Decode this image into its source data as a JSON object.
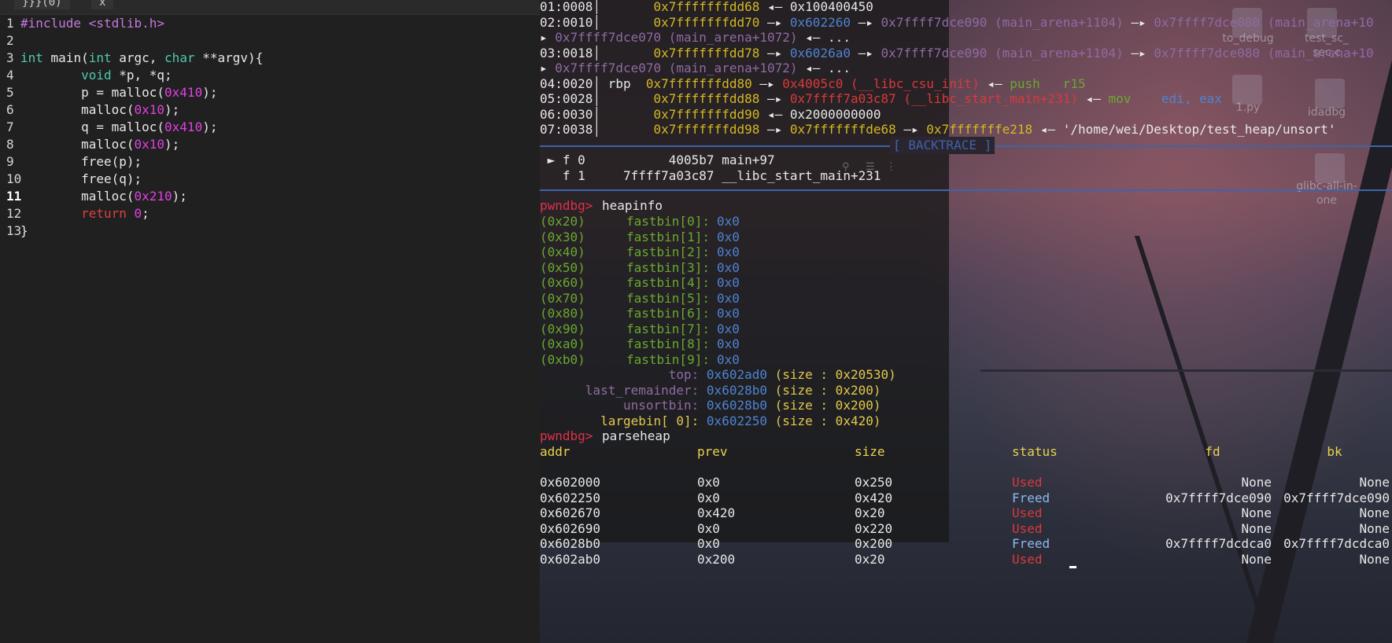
{
  "editor": {
    "tabs": [
      "}}}(0)",
      "x"
    ],
    "lines": [
      {
        "n": "1",
        "parts": [
          [
            "pp",
            "#include "
          ],
          [
            "pp2",
            "<stdlib.h>"
          ]
        ]
      },
      {
        "n": "2",
        "parts": []
      },
      {
        "n": "3",
        "parts": [
          [
            "ty",
            "int"
          ],
          [
            "tx",
            " main("
          ],
          [
            "ty",
            "int"
          ],
          [
            "tx",
            " argc, "
          ],
          [
            "ty",
            "char"
          ],
          [
            "tx",
            " **argv){"
          ]
        ]
      },
      {
        "n": "4",
        "parts": [
          [
            "tx",
            "        "
          ],
          [
            "ty",
            "void"
          ],
          [
            "tx",
            " *p, *q;"
          ]
        ]
      },
      {
        "n": "5",
        "parts": [
          [
            "tx",
            "        p = malloc("
          ],
          [
            "num",
            "0x410"
          ],
          [
            "tx",
            ");"
          ]
        ]
      },
      {
        "n": "6",
        "parts": [
          [
            "tx",
            "        malloc("
          ],
          [
            "num",
            "0x10"
          ],
          [
            "tx",
            ");"
          ]
        ]
      },
      {
        "n": "7",
        "parts": [
          [
            "tx",
            "        q = malloc("
          ],
          [
            "num",
            "0x410"
          ],
          [
            "tx",
            ");"
          ]
        ]
      },
      {
        "n": "8",
        "parts": [
          [
            "tx",
            "        malloc("
          ],
          [
            "num",
            "0x10"
          ],
          [
            "tx",
            ");"
          ]
        ]
      },
      {
        "n": "9",
        "parts": [
          [
            "tx",
            "        free(p);"
          ]
        ]
      },
      {
        "n": "10",
        "parts": [
          [
            "tx",
            "        free(q);"
          ]
        ]
      },
      {
        "n": "11",
        "parts": [
          [
            "tx",
            "        malloc("
          ],
          [
            "num",
            "0x210"
          ],
          [
            "tx",
            ");"
          ]
        ]
      },
      {
        "n": "12",
        "parts": [
          [
            "tx",
            "        "
          ],
          [
            "kw",
            "return"
          ],
          [
            "tx",
            " "
          ],
          [
            "num",
            "0"
          ],
          [
            "tx",
            ";"
          ]
        ]
      },
      {
        "n": "13",
        "parts": [
          [
            "tx",
            "}"
          ]
        ]
      }
    ],
    "current_line": "11"
  },
  "terminal": {
    "stack": [
      [
        [
          "w",
          "01:0008"
        ],
        [
          "vbar",
          "│"
        ],
        [
          "y",
          "       0x7fffffffdd68"
        ],
        [
          "w",
          " ◂— 0x100400450"
        ]
      ],
      [
        [
          "w",
          "02:0010"
        ],
        [
          "vbar",
          "│"
        ],
        [
          "y",
          "       0x7fffffffdd70"
        ],
        [
          "w",
          " —▸ "
        ],
        [
          "b",
          "0x602260"
        ],
        [
          "w",
          " —▸ "
        ],
        [
          "p",
          "0x7ffff7dce090 (main_arena+1104)"
        ],
        [
          "w",
          " —▸ "
        ],
        [
          "p",
          "0x7ffff7dce080 (main_arena+10"
        ]
      ],
      [
        [
          "w",
          "▸ "
        ],
        [
          "p",
          "0x7ffff7dce070 (main_arena+1072)"
        ],
        [
          "w",
          " ◂— ..."
        ]
      ],
      [
        [
          "w",
          "03:0018"
        ],
        [
          "vbar",
          "│"
        ],
        [
          "y",
          "       0x7fffffffdd78"
        ],
        [
          "w",
          " —▸ "
        ],
        [
          "b",
          "0x6026a0"
        ],
        [
          "w",
          " —▸ "
        ],
        [
          "p",
          "0x7ffff7dce090 (main_arena+1104)"
        ],
        [
          "w",
          " —▸ "
        ],
        [
          "p",
          "0x7ffff7dce080 (main_arena+10"
        ]
      ],
      [
        [
          "w",
          "▸ "
        ],
        [
          "p",
          "0x7ffff7dce070 (main_arena+1072)"
        ],
        [
          "w",
          " ◂— ..."
        ]
      ],
      [
        [
          "w",
          "04:0020"
        ],
        [
          "vbar",
          "│"
        ],
        [
          "w",
          " rbp  "
        ],
        [
          "y",
          "0x7fffffffdd80"
        ],
        [
          "w",
          " —▸ "
        ],
        [
          "r",
          "0x4005c0 (__libc_csu_init)"
        ],
        [
          "w",
          " ◂— "
        ],
        [
          "g",
          "push   r15"
        ]
      ],
      [
        [
          "w",
          "05:0028"
        ],
        [
          "vbar",
          "│"
        ],
        [
          "y",
          "       0x7fffffffdd88"
        ],
        [
          "w",
          " —▸ "
        ],
        [
          "r",
          "0x7ffff7a03c87 (__libc_start_main+231)"
        ],
        [
          "w",
          " ◂— "
        ],
        [
          "g",
          "mov    "
        ],
        [
          "b",
          "edi, eax"
        ]
      ],
      [
        [
          "w",
          "06:0030"
        ],
        [
          "vbar",
          "│"
        ],
        [
          "y",
          "       0x7fffffffdd90"
        ],
        [
          "w",
          " ◂— 0x2000000000"
        ]
      ],
      [
        [
          "w",
          "07:0038"
        ],
        [
          "vbar",
          "│"
        ],
        [
          "y",
          "       0x7fffffffdd98"
        ],
        [
          "w",
          " —▸ "
        ],
        [
          "y",
          "0x7fffffffde68"
        ],
        [
          "w",
          " —▸ "
        ],
        [
          "y",
          "0x7fffffffe218"
        ],
        [
          "w",
          " ◂— '/home/wei/Desktop/test_heap/unsort'"
        ]
      ]
    ],
    "backtrace_title": "[ BACKTRACE ]",
    "backtrace": [
      [
        [
          "w",
          " ► f 0           4005b7 main+97"
        ]
      ],
      [
        [
          "w",
          "   f 1     7ffff7a03c87 __libc_start_main+231"
        ]
      ]
    ],
    "heapinfo_prompt": "pwndbg> ",
    "heapinfo_cmd": "heapinfo",
    "fastbins": [
      {
        "size": "(0x20)",
        "name": "fastbin[0]:",
        "val": "0x0"
      },
      {
        "size": "(0x30)",
        "name": "fastbin[1]:",
        "val": "0x0"
      },
      {
        "size": "(0x40)",
        "name": "fastbin[2]:",
        "val": "0x0"
      },
      {
        "size": "(0x50)",
        "name": "fastbin[3]:",
        "val": "0x0"
      },
      {
        "size": "(0x60)",
        "name": "fastbin[4]:",
        "val": "0x0"
      },
      {
        "size": "(0x70)",
        "name": "fastbin[5]:",
        "val": "0x0"
      },
      {
        "size": "(0x80)",
        "name": "fastbin[6]:",
        "val": "0x0"
      },
      {
        "size": "(0x90)",
        "name": "fastbin[7]:",
        "val": "0x0"
      },
      {
        "size": "(0xa0)",
        "name": "fastbin[8]:",
        "val": "0x0"
      },
      {
        "size": "(0xb0)",
        "name": "fastbin[9]:",
        "val": "0x0"
      }
    ],
    "bins": [
      [
        [
          "p",
          "                 top: "
        ],
        [
          "b",
          "0x602ad0"
        ],
        [
          "yl",
          " (size : 0x20530)"
        ]
      ],
      [
        [
          "p",
          "      last_remainder: "
        ],
        [
          "b",
          "0x6028b0"
        ],
        [
          "yl",
          " (size : 0x200)"
        ]
      ],
      [
        [
          "p",
          "           unsortbin: "
        ],
        [
          "b",
          "0x6028b0"
        ],
        [
          "yl",
          " (size : 0x200)"
        ]
      ],
      [
        [
          "yl",
          "        largebin[ 0]: "
        ],
        [
          "b",
          "0x602250"
        ],
        [
          "yl",
          " (size : 0x420)"
        ]
      ]
    ],
    "parseheap_prompt": "pwndbg> ",
    "parseheap_cmd": "parseheap",
    "heap_headers": [
      "addr",
      "prev",
      "size",
      "status",
      "fd",
      "bk"
    ],
    "heap_rows": [
      [
        "0x602000",
        "0x0",
        "0x250",
        "Used",
        "None",
        "None"
      ],
      [
        "0x602250",
        "0x0",
        "0x420",
        "Freed",
        "0x7ffff7dce090",
        "0x7ffff7dce090"
      ],
      [
        "0x602670",
        "0x420",
        "0x20",
        "Used",
        "None",
        "None"
      ],
      [
        "0x602690",
        "0x0",
        "0x220",
        "Used",
        "None",
        "None"
      ],
      [
        "0x6028b0",
        "0x0",
        "0x200",
        "Freed",
        "0x7ffff7dcdca0",
        "0x7ffff7dcdca0"
      ],
      [
        "0x602ab0",
        "0x200",
        "0x20",
        "Used",
        "None",
        "None"
      ]
    ]
  },
  "desktop": {
    "icons": [
      {
        "label": "to_debug"
      },
      {
        "label": "test_sc_\nsec.c"
      },
      {
        "label": "1.py"
      },
      {
        "label": "idadbg"
      },
      {
        "label": "glibc-all-in-\none"
      }
    ]
  }
}
